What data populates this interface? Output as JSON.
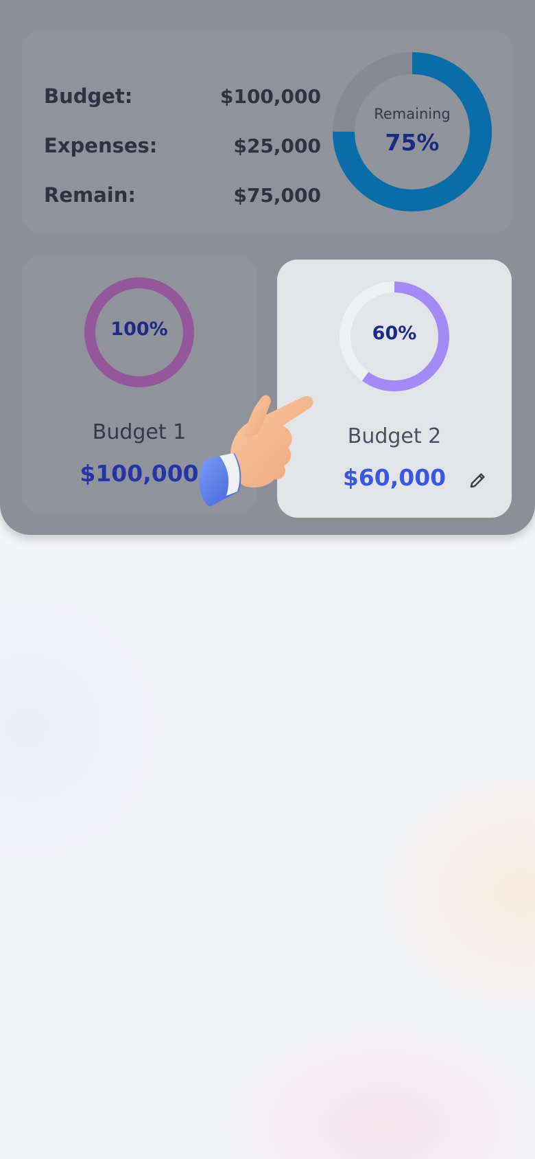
{
  "summary": {
    "rows": [
      {
        "label": "Budget:",
        "value": "$100,000"
      },
      {
        "label": "Expenses:",
        "value": "$25,000"
      },
      {
        "label": "Remain:",
        "value": "$75,000"
      }
    ],
    "donut": {
      "caption": "Remaining",
      "percent_label": "75%",
      "fraction": 0.75,
      "color": "#0a6da8",
      "track_color": "#868991"
    }
  },
  "budgets": [
    {
      "name": "Budget 1",
      "amount": "$100,000",
      "percent_label": "100%",
      "fraction": 1.0,
      "color": "#93579a"
    },
    {
      "name": "Budget 2",
      "amount": "$60,000",
      "percent_label": "60%",
      "fraction": 0.6,
      "color": "#a28bf5",
      "track_color": "#eeeff2"
    }
  ],
  "icons": {
    "edit": "pencil-icon",
    "pointer": "pointing-hand-icon"
  }
}
